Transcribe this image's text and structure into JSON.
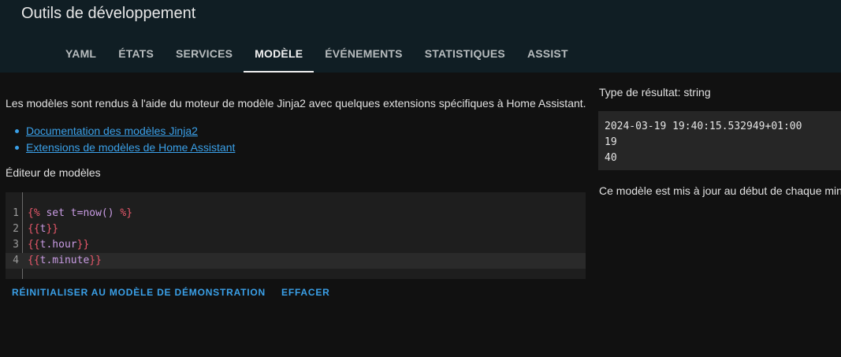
{
  "header": {
    "title": "Outils de développement",
    "tabs": [
      {
        "label": "YAML"
      },
      {
        "label": "ÉTATS"
      },
      {
        "label": "SERVICES"
      },
      {
        "label": "MODÈLE",
        "active": true
      },
      {
        "label": "ÉVÉNEMENTS"
      },
      {
        "label": "STATISTIQUES"
      },
      {
        "label": "ASSIST"
      }
    ]
  },
  "main": {
    "description": "Les modèles sont rendus à l'aide du moteur de modèle Jinja2 avec quelques extensions spécifiques à Home Assistant.",
    "links": [
      {
        "label": "Documentation des modèles Jinja2"
      },
      {
        "label": "Extensions de modèles de Home Assistant"
      }
    ],
    "editor_label": "Éditeur de modèles",
    "editor": {
      "lines": [
        {
          "number": "1",
          "text": "{% set t=now() %}"
        },
        {
          "number": "2",
          "text": "{{t}}"
        },
        {
          "number": "3",
          "text": "{{t.hour}}"
        },
        {
          "number": "4",
          "text": "{{t.minute}}"
        }
      ]
    },
    "buttons": {
      "reset": "RÉINITIALISER AU MODÈLE DE DÉMONSTRATION",
      "clear": "EFFACER"
    }
  },
  "result": {
    "type_label": "Type de résultat: string",
    "output": "2024-03-19 19:40:15.532949+01:00\n19\n40",
    "update_note": "Ce modèle est mis à jour au début de chaque minute."
  },
  "colors": {
    "header_bg": "#101e24",
    "page_bg": "#111111",
    "link": "#3aa0e8",
    "template_delimiter": "#e8586b",
    "template_expression": "#c99ce4"
  }
}
